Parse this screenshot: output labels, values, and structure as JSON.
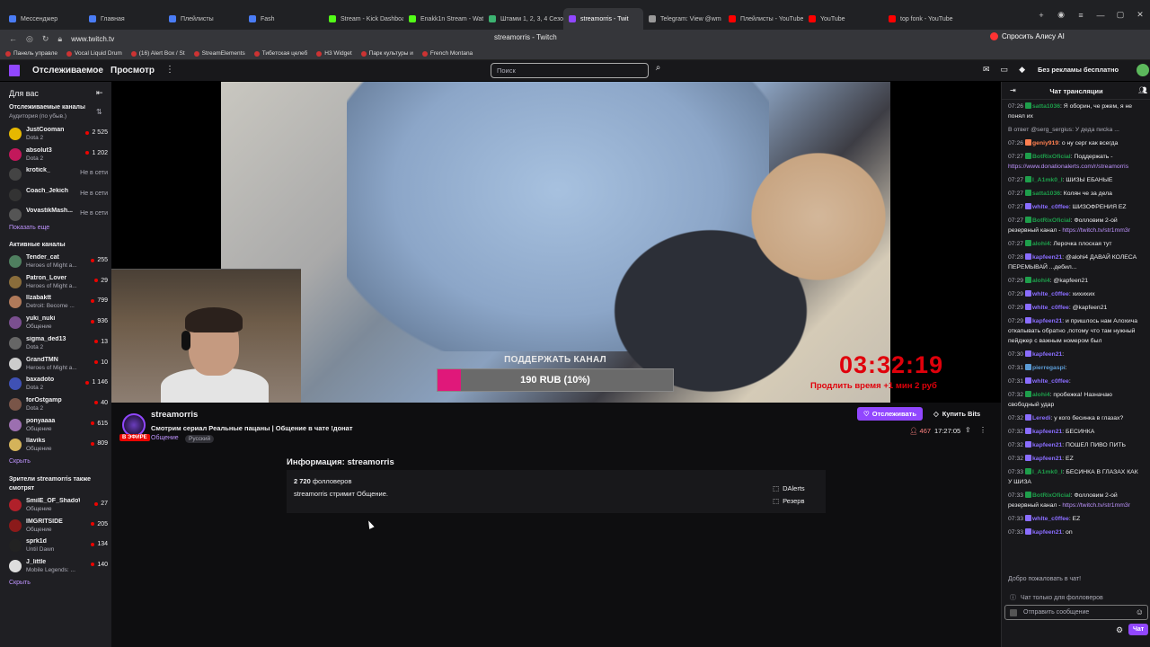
{
  "browser": {
    "tabs": [
      {
        "label": "Мессенджер",
        "color": "#4a7cf5"
      },
      {
        "label": "Главная",
        "color": "#4a7cf5"
      },
      {
        "label": "Плейлисты",
        "color": "#4a7cf5"
      },
      {
        "label": "Fash",
        "color": "#4a7cf5"
      },
      {
        "label": "Stream - Kick Dashboa",
        "color": "#53fc18"
      },
      {
        "label": "Enakk1n Stream - Wat",
        "color": "#53fc18"
      },
      {
        "label": "Штамм 1, 2, 3, 4 Сезо",
        "color": "#3cb371"
      },
      {
        "label": "streamorris - Twit",
        "color": "#9147ff",
        "active": true
      },
      {
        "label": "Telegram: View @wm",
        "color": "#999999"
      },
      {
        "label": "Плейлисты - YouTube",
        "color": "#ff0000"
      },
      {
        "label": "YouTube",
        "color": "#ff0000"
      },
      {
        "label": "top fonk - YouTube",
        "color": "#ff0000"
      }
    ],
    "url": "www.twitch.tv",
    "page_title": "streamorris - Twitch",
    "ask_alice": "Спросить Алису AI",
    "bookmarks": [
      "Панель управле",
      "Vocal Liquid Drum",
      "(16) Alert Box / St",
      "StreamElements",
      "Тибетская целеб",
      "H3 Widget",
      "Парк культуры и",
      "French Montana"
    ]
  },
  "twitch_nav": {
    "following": "Отслеживаемое",
    "browse": "Просмотр",
    "more": "⋮",
    "search_placeholder": "Поиск",
    "no_ads": "Без рекламы бесплатно"
  },
  "sidebar": {
    "header": "Для вас",
    "followed_title": "Отслеживаемые каналы",
    "followed_sub": "Аудитория (по убыв.)",
    "followed": [
      {
        "name": "JustCooman",
        "game": "Dota 2",
        "viewers": "2 525",
        "avatar": "#e6b800"
      },
      {
        "name": "absolut3",
        "game": "Dota 2",
        "viewers": "1 202",
        "avatar": "#c2185b"
      },
      {
        "name": "krotick_",
        "offline": "Не в сети",
        "avatar": "#444444"
      },
      {
        "name": "Coach_Jekich",
        "offline": "Не в сети",
        "avatar": "#333333"
      },
      {
        "name": "VovastikMash...",
        "offline": "Не в сети",
        "avatar": "#555555"
      }
    ],
    "show_more": "Показать еще",
    "active_title": "Активные каналы",
    "active": [
      {
        "name": "Tender_cat",
        "game": "Heroes of Might a...",
        "viewers": "255",
        "avatar": "#4f7f5f"
      },
      {
        "name": "Patron_Lover",
        "game": "Heroes of Might a...",
        "viewers": "29",
        "avatar": "#8a6d3b"
      },
      {
        "name": "Ilzabaktt",
        "game": "Detroit: Become ...",
        "viewers": "799",
        "avatar": "#b07a5a"
      },
      {
        "name": "yuki_nuki",
        "game": "Общение",
        "viewers": "936",
        "avatar": "#7a4f8f"
      },
      {
        "name": "sigma_ded13",
        "game": "Dota 2",
        "viewers": "13",
        "avatar": "#666666"
      },
      {
        "name": "GrandTMN",
        "game": "Heroes of Might a...",
        "viewers": "10",
        "avatar": "#cccccc"
      },
      {
        "name": "baxadoto",
        "game": "Dota 2",
        "viewers": "1 146",
        "avatar": "#3f51b5"
      },
      {
        "name": "forOstgamp",
        "game": "Dota 2",
        "viewers": "40",
        "avatar": "#795548"
      },
      {
        "name": "ponyaaaa",
        "game": "Общение",
        "viewers": "615",
        "avatar": "#9c6fb0"
      },
      {
        "name": "llaviks",
        "game": "Общение",
        "viewers": "809",
        "avatar": "#d4b35a"
      }
    ],
    "hide_active": "Скрыть",
    "also_title": "Зрители streamorris также смотрят",
    "also": [
      {
        "name": "SmilE_OF_ShadoW",
        "game": "Общение",
        "viewers": "27",
        "avatar": "#b0202a"
      },
      {
        "name": "IMGRITSIDE",
        "game": "Общение",
        "viewers": "205",
        "avatar": "#8b1a1a"
      },
      {
        "name": "sprk1d",
        "game": "Until Dawn",
        "viewers": "134",
        "avatar": "#222222"
      },
      {
        "name": "J_little",
        "game": "Mobile Legends: ...",
        "viewers": "140",
        "avatar": "#dddddd"
      }
    ],
    "hide_also": "Скрыть"
  },
  "player": {
    "support_label": "ПОДДЕРЖАТЬ КАНАЛ",
    "donation_text": "190 RUB (10%)",
    "donation_progress_pct": 10,
    "timer": "03:32:19",
    "timer_extend": "Продлить время +1 мин 2 руб"
  },
  "stream": {
    "channel": "streamorris",
    "live_badge": "В ЭФИРЕ",
    "title": "Смотрим сериал Реальные пацаны | Общение в чате !донат",
    "category": "Общение",
    "tag": "Русский",
    "follow_btn": "Отслеживать",
    "bits_btn": "Купить Bits",
    "viewers": "467",
    "uptime": "17:27:05",
    "about_heading": "Информация: streamorris",
    "followers_count": "2 720",
    "followers_label": "фолловеров",
    "description": "streamorris стримит Общение.",
    "links": [
      "DAlerts",
      "Резерв"
    ]
  },
  "chat": {
    "title": "Чат трансляции",
    "messages": [
      {
        "time": "07:26",
        "user": "satta1036",
        "color": "#1e9e4b",
        "text": ": Я оборин, че ржем, я не понял их"
      },
      {
        "reply": "В ответ @serg_sergius: У деда пиcka ..."
      },
      {
        "time": "07:26",
        "user": "geniy919",
        "color": "#ff7f50",
        "text": ": о ну серг как всегда"
      },
      {
        "time": "07:27",
        "user": "BotRixOficial",
        "color": "#1e9e4b",
        "text": ": Поддержать - ",
        "link": "https://www.donationalerts.com/r/streamorris"
      },
      {
        "time": "07:27",
        "user": "l_A1mk0_l",
        "color": "#1e9e4b",
        "text": ": ШИЗЫ ЕБАНЫЕ"
      },
      {
        "time": "07:27",
        "user": "satta1036",
        "color": "#1e9e4b",
        "text": ": Колян че за дела"
      },
      {
        "time": "07:27",
        "user": "whlte_c0ffee",
        "color": "#8a6dff",
        "text": ": ШИЗОФРЕНИЯ EZ"
      },
      {
        "time": "07:27",
        "user": "BotRixOficial",
        "color": "#1e9e4b",
        "text": ": Фолловим 2-ой резервный канал - ",
        "link": "https://twitch.tv/str1mm3r"
      },
      {
        "time": "07:27",
        "user": "alohi4",
        "color": "#1e9e4b",
        "text": ": Лерочка плоская тут"
      },
      {
        "time": "07:28",
        "user": "kapfeen21",
        "color": "#8a6dff",
        "text": ": @alohi4 ДАВАЙ КОЛЕСА ПЕРЕМЫВАЙ ...дебил..."
      },
      {
        "time": "07:29",
        "user": "alohi4",
        "color": "#1e9e4b",
        "text": ": @kapfeen21"
      },
      {
        "time": "07:29",
        "user": "whlte_c0ffee",
        "color": "#8a6dff",
        "text": ": хихихих"
      },
      {
        "time": "07:29",
        "user": "whlte_c0ffee",
        "color": "#8a6dff",
        "text": ": @kapfeen21"
      },
      {
        "time": "07:29",
        "user": "kapfeen21",
        "color": "#8a6dff",
        "text": ": и пришлось нам Алохича откапывать обратно ,потому что там нужный пейджер с важным номером был"
      },
      {
        "time": "07:30",
        "user": "kapfeen21",
        "color": "#8a6dff",
        "text": ":"
      },
      {
        "time": "07:31",
        "user": "pierregaspi",
        "color": "#5b9bd5",
        "text": ":"
      },
      {
        "time": "07:31",
        "user": "whlte_c0ffee",
        "color": "#8a6dff",
        "text": ":"
      },
      {
        "time": "07:32",
        "user": "alohi4",
        "color": "#1e9e4b",
        "text": ": пробежка! Назначаю свободный удар"
      },
      {
        "time": "07:32",
        "user": "Leredi",
        "color": "#8a6dff",
        "text": ": у кого бесинка в глазах?"
      },
      {
        "time": "07:32",
        "user": "kapfeen21",
        "color": "#8a6dff",
        "text": ": БЕСИНКА"
      },
      {
        "time": "07:32",
        "user": "kapfeen21",
        "color": "#8a6dff",
        "text": ": ПОШЕЛ ПИВО ПИТЬ"
      },
      {
        "time": "07:32",
        "user": "kapfeen21",
        "color": "#8a6dff",
        "text": ": EZ"
      },
      {
        "time": "07:33",
        "user": "l_A1mk0_l",
        "color": "#1e9e4b",
        "text": ": БЕСИНКА В ГЛАЗАХ КАК У ШИЗА"
      },
      {
        "time": "07:33",
        "user": "BotRixOficial",
        "color": "#1e9e4b",
        "text": ": Фолловим 2-ой резервный канал - ",
        "link": "https://twitch.tv/str1mm3r"
      },
      {
        "time": "07:33",
        "user": "whlte_c0ffee",
        "color": "#8a6dff",
        "text": ": EZ"
      },
      {
        "time": "07:33",
        "user": "kapfeen21",
        "color": "#8a6dff",
        "text": ": on"
      }
    ],
    "welcome": "Добро пожаловать в чат!",
    "followers_only": "Чат только для фолловеров",
    "input_placeholder": "Отправить сообщение",
    "send_btn": "Чат"
  }
}
